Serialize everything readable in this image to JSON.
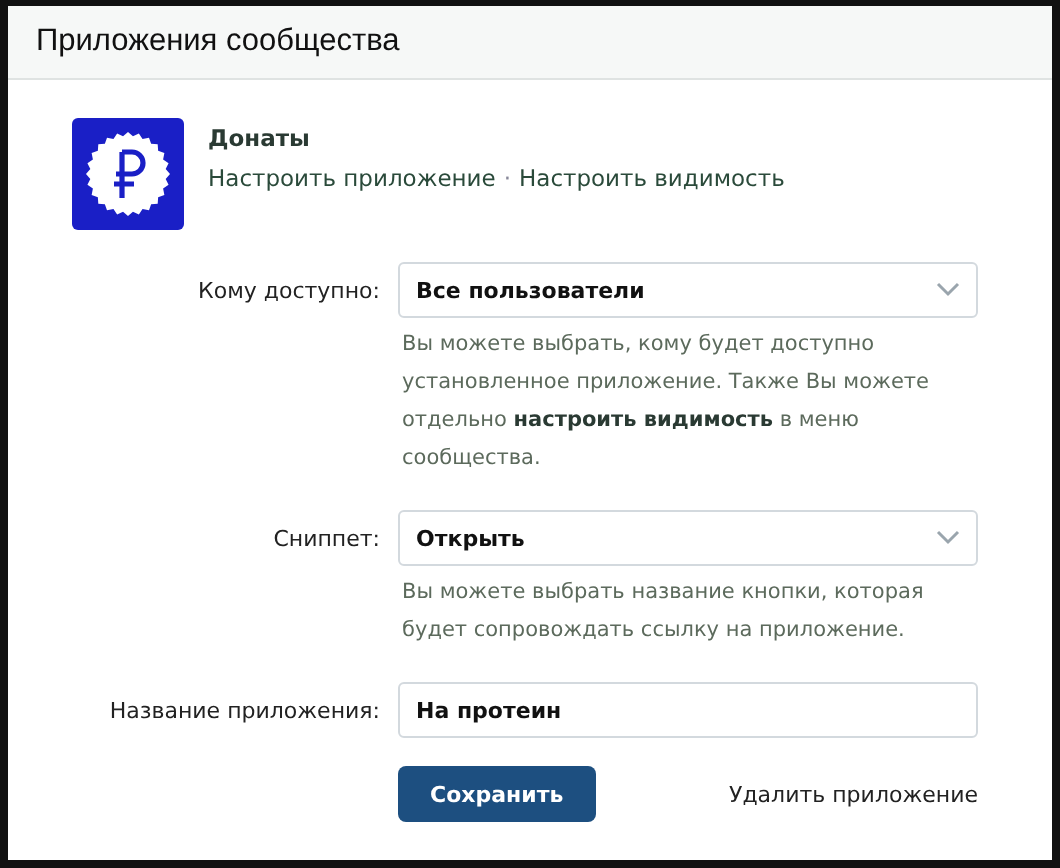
{
  "header": {
    "title": "Приложения сообщества"
  },
  "app": {
    "name": "Донаты",
    "links": [
      "Настроить приложение",
      "Настроить видимость"
    ],
    "separator": "·"
  },
  "fields": [
    {
      "kind": "select",
      "label": "Кому доступно:",
      "value": "Все пользователи",
      "hint": {
        "before": "Вы можете выбрать, кому будет доступно установленное приложение. Также Вы можете отдельно ",
        "link": "настроить видимость",
        "after": " в меню сообщества."
      }
    },
    {
      "kind": "select",
      "label": "Сниппет:",
      "value": "Открыть",
      "hint": {
        "before": "Вы можете выбрать название кнопки, которая будет сопровождать ссылку на приложение."
      }
    },
    {
      "kind": "input",
      "label": "Название приложения:",
      "value": "На протеин"
    }
  ],
  "actions": {
    "save": "Сохранить",
    "delete": "Удалить приложение"
  }
}
